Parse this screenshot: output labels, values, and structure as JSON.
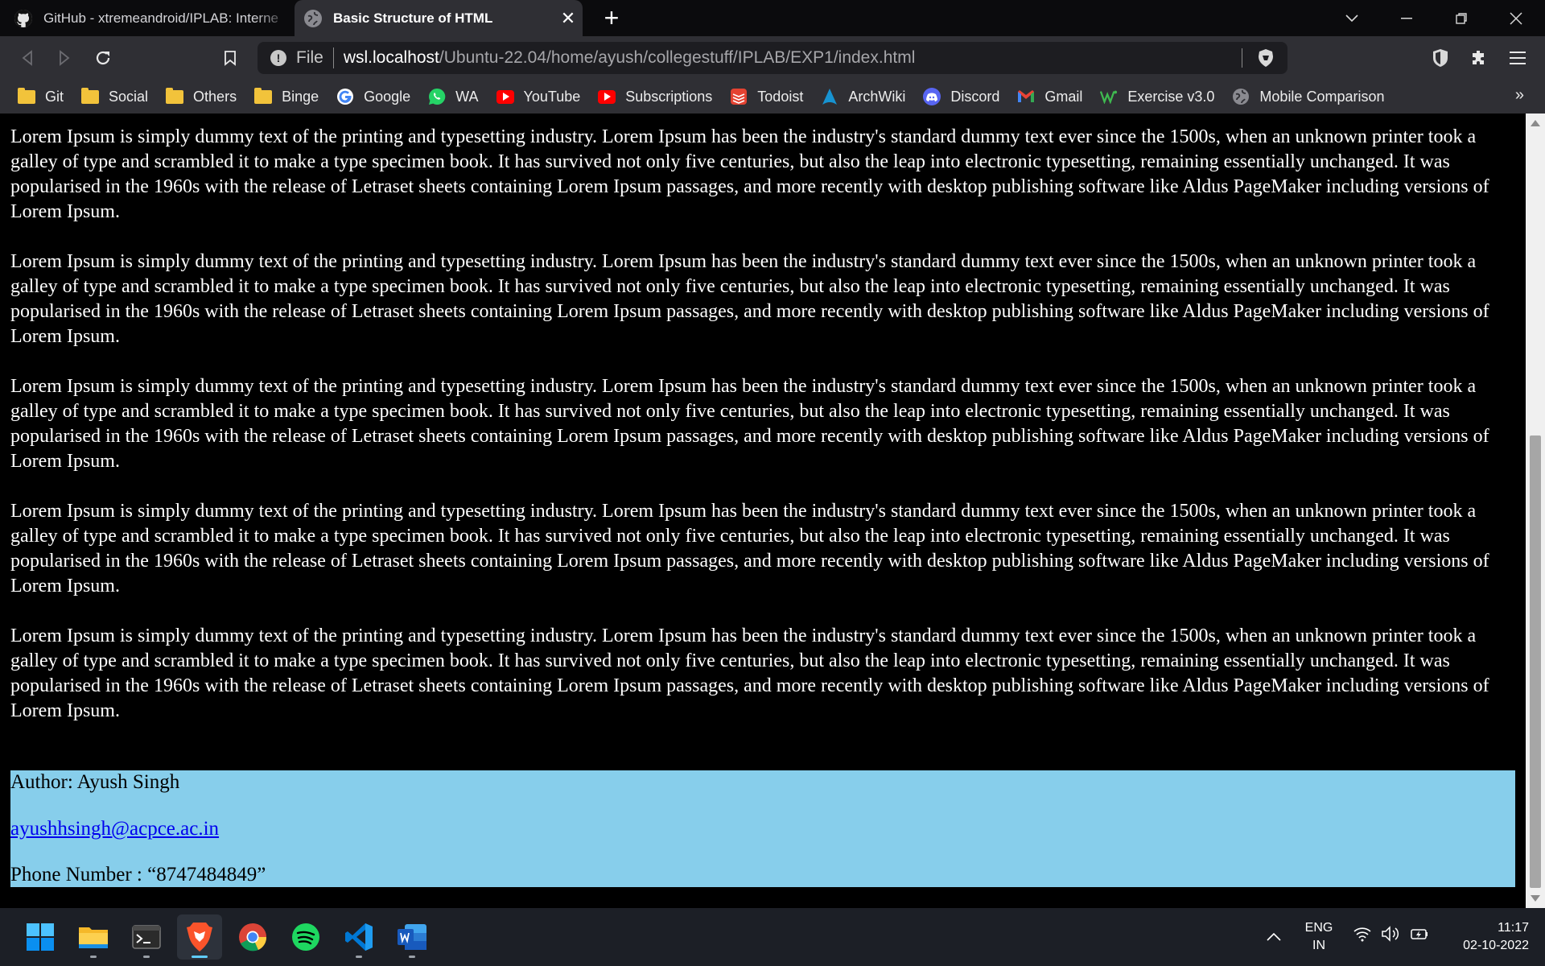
{
  "tabs": [
    {
      "title": "GitHub - xtremeandroid/IPLAB: Interne",
      "active": false
    },
    {
      "title": "Basic Structure of HTML",
      "active": true
    }
  ],
  "toolbar": {
    "scheme": "File",
    "url_host": "wsl.localhost",
    "url_path": "/Ubuntu-22.04/home/ayush/collegestuff/IPLAB/EXP1/index.html"
  },
  "bookmarks": [
    {
      "label": "Git",
      "icon": "folder-icon"
    },
    {
      "label": "Social",
      "icon": "folder-icon"
    },
    {
      "label": "Others",
      "icon": "folder-icon"
    },
    {
      "label": "Binge",
      "icon": "folder-icon"
    },
    {
      "label": "Google",
      "icon": "google-icon"
    },
    {
      "label": "WA",
      "icon": "whatsapp-icon"
    },
    {
      "label": "YouTube",
      "icon": "youtube-icon"
    },
    {
      "label": "Subscriptions",
      "icon": "youtube-icon"
    },
    {
      "label": "Todoist",
      "icon": "todoist-icon"
    },
    {
      "label": "ArchWiki",
      "icon": "archwiki-icon"
    },
    {
      "label": "Discord",
      "icon": "discord-icon"
    },
    {
      "label": "Gmail",
      "icon": "gmail-icon"
    },
    {
      "label": "Exercise v3.0",
      "icon": "exercise-icon"
    },
    {
      "label": "Mobile Comparison",
      "icon": "globe-icon"
    }
  ],
  "page": {
    "paragraphs": [
      "Lorem Ipsum is simply dummy text of the printing and typesetting industry. Lorem Ipsum has been the industry's standard dummy text ever since the 1500s, when an unknown printer took a galley of type and scrambled it to make a type specimen book. It has survived not only five centuries, but also the leap into electronic typesetting, remaining essentially unchanged. It was popularised in the 1960s with the release of Letraset sheets containing Lorem Ipsum passages, and more recently with desktop publishing software like Aldus PageMaker including versions of Lorem Ipsum.",
      "Lorem Ipsum is simply dummy text of the printing and typesetting industry. Lorem Ipsum has been the industry's standard dummy text ever since the 1500s, when an unknown printer took a galley of type and scrambled it to make a type specimen book. It has survived not only five centuries, but also the leap into electronic typesetting, remaining essentially unchanged. It was popularised in the 1960s with the release of Letraset sheets containing Lorem Ipsum passages, and more recently with desktop publishing software like Aldus PageMaker including versions of Lorem Ipsum.",
      "Lorem Ipsum is simply dummy text of the printing and typesetting industry. Lorem Ipsum has been the industry's standard dummy text ever since the 1500s, when an unknown printer took a galley of type and scrambled it to make a type specimen book. It has survived not only five centuries, but also the leap into electronic typesetting, remaining essentially unchanged. It was popularised in the 1960s with the release of Letraset sheets containing Lorem Ipsum passages, and more recently with desktop publishing software like Aldus PageMaker including versions of Lorem Ipsum.",
      "Lorem Ipsum is simply dummy text of the printing and typesetting industry. Lorem Ipsum has been the industry's standard dummy text ever since the 1500s, when an unknown printer took a galley of type and scrambled it to make a type specimen book. It has survived not only five centuries, but also the leap into electronic typesetting, remaining essentially unchanged. It was popularised in the 1960s with the release of Letraset sheets containing Lorem Ipsum passages, and more recently with desktop publishing software like Aldus PageMaker including versions of Lorem Ipsum.",
      "Lorem Ipsum is simply dummy text of the printing and typesetting industry. Lorem Ipsum has been the industry's standard dummy text ever since the 1500s, when an unknown printer took a galley of type and scrambled it to make a type specimen book. It has survived not only five centuries, but also the leap into electronic typesetting, remaining essentially unchanged. It was popularised in the 1960s with the release of Letraset sheets containing Lorem Ipsum passages, and more recently with desktop publishing software like Aldus PageMaker including versions of Lorem Ipsum."
    ],
    "footer": {
      "author": "Author: Ayush Singh",
      "email": "ayushhsingh@acpce.ac.in",
      "phone": "Phone Number : “8747484849”",
      "background": "#87ceeb"
    }
  },
  "taskbar": {
    "apps": [
      {
        "name": "start-icon"
      },
      {
        "name": "file-explorer-icon"
      },
      {
        "name": "terminal-icon"
      },
      {
        "name": "brave-icon",
        "active": true
      },
      {
        "name": "chrome-icon"
      },
      {
        "name": "spotify-icon"
      },
      {
        "name": "vscode-icon"
      },
      {
        "name": "word-icon"
      }
    ],
    "lang_line1": "ENG",
    "lang_line2": "IN",
    "time": "11:17",
    "date": "02-10-2022"
  },
  "colors": {
    "page_bg": "#000000",
    "page_text": "#ffffff",
    "footer_bg": "#87ceeb",
    "link": "#0000ee",
    "accent": "#60cdff"
  }
}
